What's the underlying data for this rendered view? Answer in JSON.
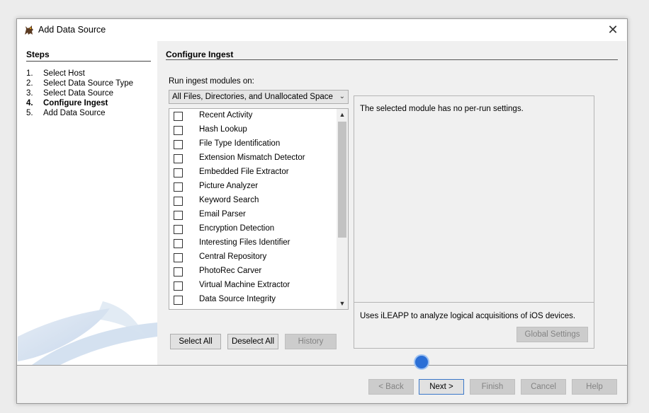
{
  "window": {
    "title": "Add Data Source",
    "close_label": "✕"
  },
  "steps": {
    "heading": "Steps",
    "items": [
      {
        "num": "1.",
        "label": "Select Host"
      },
      {
        "num": "2.",
        "label": "Select Data Source Type"
      },
      {
        "num": "3.",
        "label": "Select Data Source"
      },
      {
        "num": "4.",
        "label": "Configure Ingest"
      },
      {
        "num": "5.",
        "label": "Add Data Source"
      }
    ]
  },
  "main": {
    "heading": "Configure Ingest",
    "run_label": "Run ingest modules on:",
    "run_selected": "All Files, Directories, and Unallocated Space",
    "modules": [
      "Recent Activity",
      "Hash Lookup",
      "File Type Identification",
      "Extension Mismatch Detector",
      "Embedded File Extractor",
      "Picture Analyzer",
      "Keyword Search",
      "Email Parser",
      "Encryption Detection",
      "Interesting Files Identifier",
      "Central Repository",
      "PhotoRec Carver",
      "Virtual Machine Extractor",
      "Data Source Integrity"
    ],
    "select_all": "Select All",
    "deselect_all": "Deselect All",
    "history": "History",
    "settings_text": "The selected module has no per-run settings.",
    "module_description": "Uses iLEAPP to analyze logical acquisitions of iOS devices.",
    "global_settings": "Global Settings"
  },
  "footer": {
    "back": "< Back",
    "next": "Next >",
    "finish": "Finish",
    "cancel": "Cancel",
    "help": "Help"
  }
}
